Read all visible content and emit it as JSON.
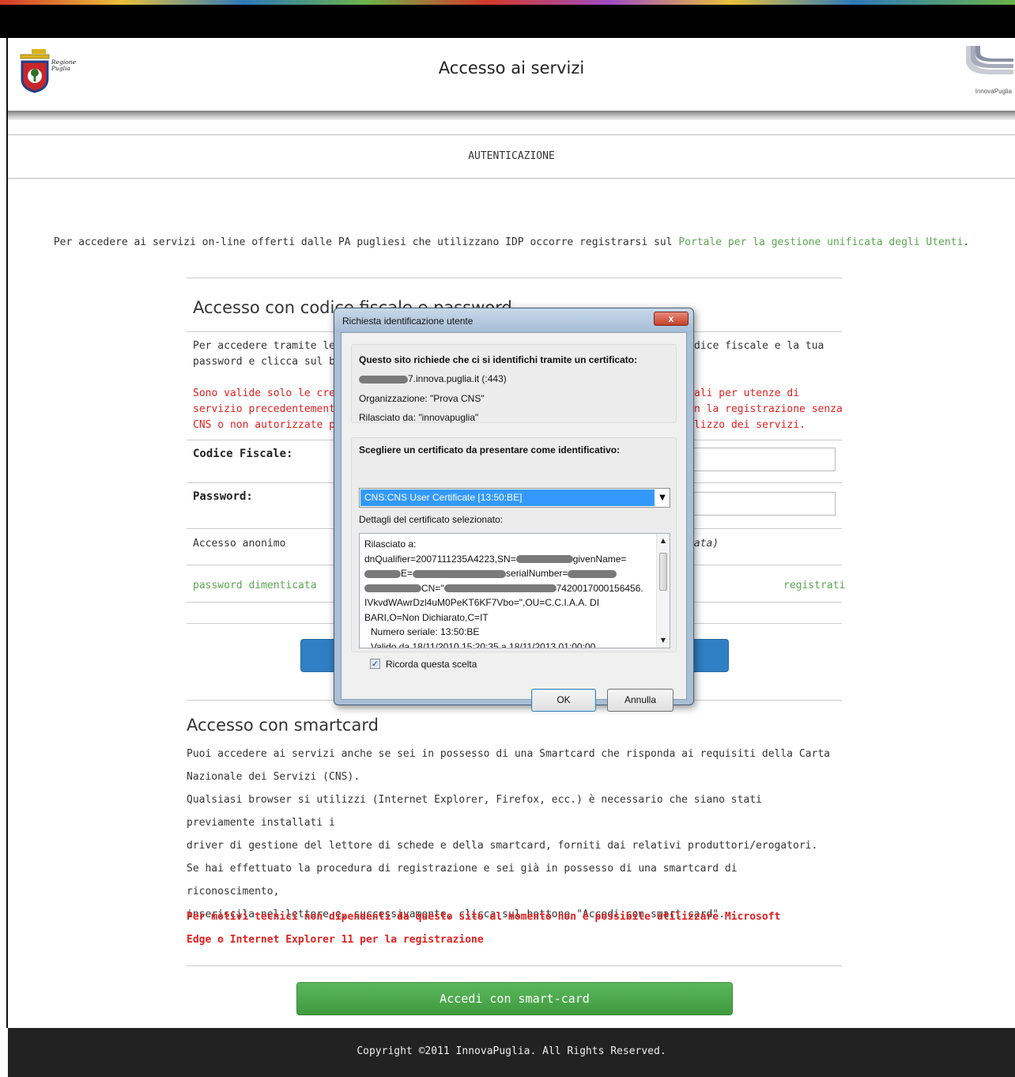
{
  "header": {
    "title": "Accesso ai servizi",
    "logo_left_text": "Regione Puglia",
    "logo_right_text": "InnovaPuglia"
  },
  "subnav": {
    "label": "AUTENTICAZIONE"
  },
  "intro": {
    "text": "Per accedere ai servizi on-line offerti dalle PA pugliesi che utilizzano IDP occorre registrarsi sul ",
    "link": "Portale per la gestione unificata degli Utenti",
    "suffix": "."
  },
  "login_section": {
    "title_visible": "Accesso con codice fiscale e password",
    "desc_line1_left": "Per accedere tramite le",
    "desc_line1_right": "dice fiscale e la tua",
    "desc_line2_left": "password e clicca sul bo",
    "red_line1_left": "Sono valide solo le crede",
    "red_line1_right": "ali per utenze di",
    "red_line2_left": "servizio precedentement",
    "red_line2_right": "n la registrazione senza",
    "red_line3_left": "CNS o non autorizzate p",
    "red_line3_right": "lizzo dei servizi.",
    "codice_fiscale_label": "Codice Fiscale:",
    "password_label": "Password:",
    "anon_left": "Accesso anonimo",
    "anon_right": "nata)",
    "forgot_link": "password dimenticata",
    "register_link": "registrati"
  },
  "smartcard_section": {
    "title": "Accesso con smartcard",
    "lines": [
      "Puoi accedere ai servizi anche se sei in possesso di una Smartcard che risponda ai requisiti della Carta",
      "Nazionale dei Servizi (CNS).",
      "Qualsiasi browser si utilizzi (Internet Explorer, Firefox, ecc.) è necessario che siano stati previamente installati i",
      "driver di gestione del lettore di schede e della smartcard, forniti dai relativi produttori/erogatori.",
      "Se hai effettuato la procedura di registrazione e sei già in possesso di una smartcard di riconoscimento,",
      "inseriscila nel lettore e, successivamente, clicca sul bottone \"Accedi con smart-card\"."
    ],
    "warning_line1": "Per motivi tecnici non dipendenti da questo sito al momento non è possibile utilizzare Microsoft",
    "warning_line2": "Edge o Internet Explorer 11 per la registrazione",
    "button_label": "Accedi con smart-card"
  },
  "footer": {
    "text": "Copyright ©2011 InnovaPuglia. All Rights Reserved."
  },
  "dialog": {
    "title": "Richiesta identificazione utente",
    "close_label": "x",
    "heading": "Questo sito richiede che ci si identifichi tramite un certificato:",
    "site": "7.innova.puglia.it (:443)",
    "organization": "Organizzazione: \"Prova CNS\"",
    "issuer": "Rilasciato da: \"innovapuglia\"",
    "choose_label": "Scegliere un certificato da presentare come identificativo:",
    "selected_certificate": "CNS:CNS User Certificate [13:50:BE]",
    "details_label": "Dettagli del certificato selezionato:",
    "details": {
      "l1": "Rilasciato a:",
      "l2a": "dnQualifier=2007111235A4223,SN=",
      "l2b": "givenName=",
      "l3a": "E=",
      "l3b": "serialNumber=",
      "l4a": "CN=\"",
      "l4b": "7420017000156456.",
      "l5": "IVkvdWAwrDzl4uM0PeKT6KF7Vbo=\",OU=C.C.I.A.A. DI",
      "l6": "BARI,O=Non Dichiarato,C=IT",
      "l7": "Numero seriale: 13:50:BE",
      "l8": "Valido da 18/11/2010 15:20:35 a 18/11/2013 01:00:00"
    },
    "remember_label": "Ricorda questa scelta",
    "remember_checked": true,
    "ok_label": "OK",
    "cancel_label": "Annulla"
  },
  "colors": {
    "link_green": "#5aa650",
    "warning_red": "#e02020",
    "primary_blue": "#2f7fc5",
    "success_green": "#4cae4c",
    "selection_blue": "#3399ff"
  }
}
